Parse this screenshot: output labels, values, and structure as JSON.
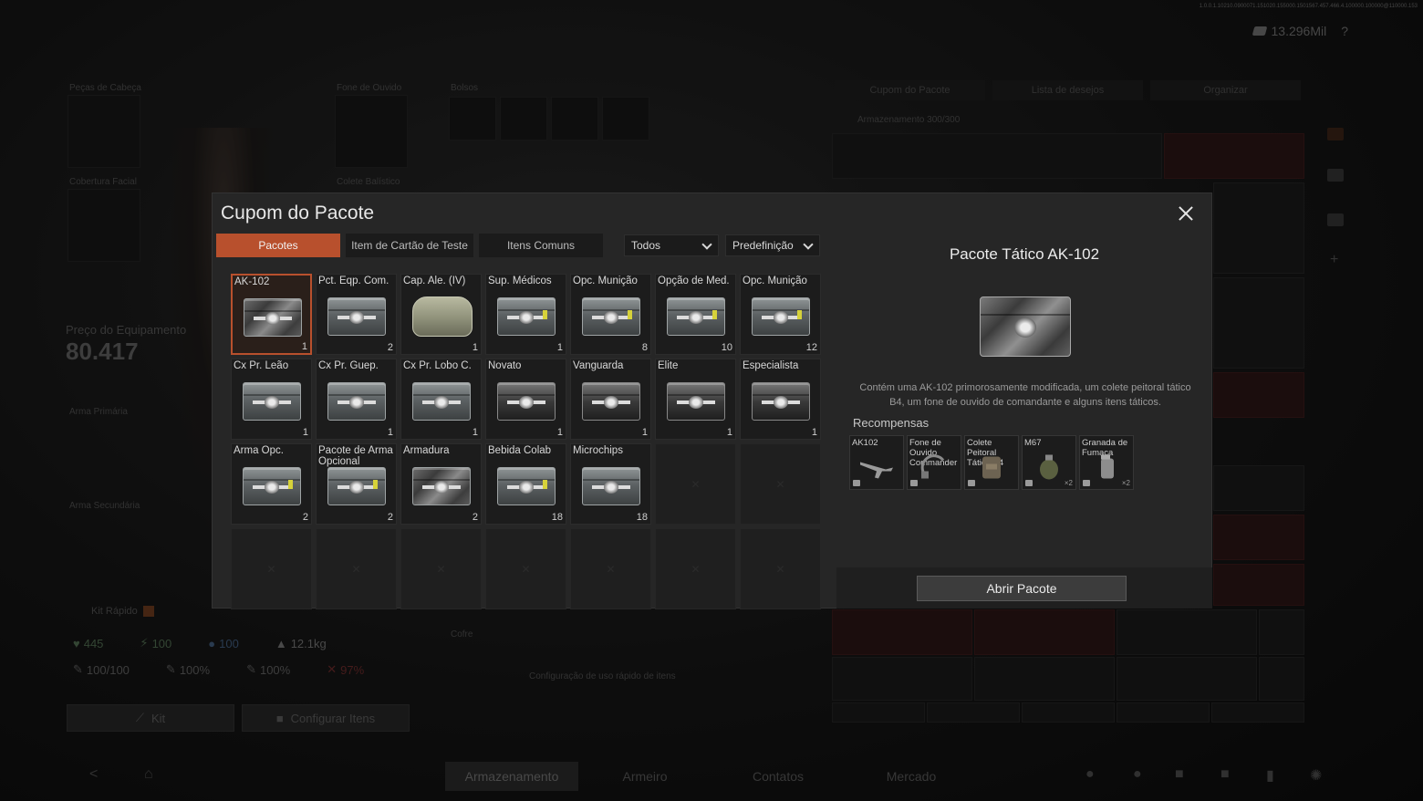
{
  "background": {
    "version": "1.0.0.1.10210.0900071.151020.155000.1501567.457.466.4.100000.100000@110000.153",
    "currency": "13.296Mil",
    "help": "?",
    "labels": {
      "face_cover": "Peças de Cabeça",
      "headphones": "Fone de Ouvido",
      "pockets": "Bolsos",
      "face_shield": "Cobertura Facial",
      "vest": "Colete Balístico",
      "primary": "Arma Primária",
      "secondary": "Arma Secundária",
      "safe": "Cofre",
      "quick_config": "Configuração de uso rápido de itens",
      "storage": "Armazenamento 300/300"
    },
    "equipment_price_label": "Preço do Equipamento",
    "equipment_price": "80.417",
    "kit_rapido": "Kit Rápido",
    "stats": {
      "health": "445",
      "energy": "100",
      "water": "100",
      "weight": "12.1kg",
      "durability": "100/100",
      "stat2": "100%",
      "stat3": "100%",
      "stat4": "97%"
    },
    "buttons": {
      "kit": "Kit",
      "configure": "Configurar Itens"
    },
    "nav": [
      "Armazenamento",
      "Armeiro",
      "Contatos",
      "Mercado"
    ],
    "right_tabs": [
      "Cupom do Pacote",
      "Lista de desejos",
      "Organizar"
    ]
  },
  "modal": {
    "title": "Cupom do Pacote",
    "tabs": [
      {
        "label": "Pacotes",
        "active": true
      },
      {
        "label": "Item de Cartão de Teste",
        "active": false
      },
      {
        "label": "Itens Comuns",
        "active": false
      }
    ],
    "filter": {
      "value": "Todos"
    },
    "sort": {
      "value": "Predefinição"
    },
    "items": [
      {
        "name": "AK-102",
        "qty": "1",
        "art": "camo",
        "selected": true
      },
      {
        "name": "Pct. Eqp. Com.",
        "qty": "2",
        "art": "plain"
      },
      {
        "name": "Cap. Ale. (IV)",
        "qty": "1",
        "art": "bag"
      },
      {
        "name": "Sup. Médicos",
        "qty": "1",
        "art": "latch"
      },
      {
        "name": "Opc. Munição",
        "qty": "8",
        "art": "latch"
      },
      {
        "name": "Opção de Med.",
        "qty": "10",
        "art": "latch"
      },
      {
        "name": "Opc. Munição",
        "qty": "12",
        "art": "latch"
      },
      {
        "name": "Cx Pr. Leão",
        "qty": "1",
        "art": "plain"
      },
      {
        "name": "Cx Pr. Guep.",
        "qty": "1",
        "art": "plain"
      },
      {
        "name": "Cx Pr. Lobo C.",
        "qty": "1",
        "art": "plain"
      },
      {
        "name": "Novato",
        "qty": "1",
        "art": "dark"
      },
      {
        "name": "Vanguarda",
        "qty": "1",
        "art": "dark"
      },
      {
        "name": "Elite",
        "qty": "1",
        "art": "dark"
      },
      {
        "name": "Especialista",
        "qty": "1",
        "art": "dark"
      },
      {
        "name": "Arma Opc.",
        "qty": "2",
        "art": "latch"
      },
      {
        "name": "Pacote de Arma Opcional",
        "qty": "2",
        "art": "latch"
      },
      {
        "name": "Armadura",
        "qty": "2",
        "art": "camo"
      },
      {
        "name": "Bebida Colab",
        "qty": "18",
        "art": "latch"
      },
      {
        "name": "Microchips",
        "qty": "18",
        "art": "plain"
      }
    ],
    "empty_slots": 9,
    "detail": {
      "title": "Pacote Tático AK-102",
      "description": "Contém uma AK-102 primorosamente modificada, um colete peitoral tático B4, um fone de ouvido de comandante e alguns itens táticos.",
      "rewards_label": "Recompensas",
      "rewards": [
        {
          "name": "AK102",
          "mult": "",
          "icon": "rifle-icon"
        },
        {
          "name": "Fone de Ouvido Commander",
          "mult": "",
          "icon": "headset-icon"
        },
        {
          "name": "Colete Peitoral Tático B4",
          "mult": "",
          "icon": "vest-icon"
        },
        {
          "name": "M67",
          "mult": "×2",
          "icon": "grenade-icon"
        },
        {
          "name": "Granada de Fumaça",
          "mult": "×2",
          "icon": "smoke-grenade-icon"
        }
      ],
      "open_button": "Abrir Pacote"
    }
  }
}
